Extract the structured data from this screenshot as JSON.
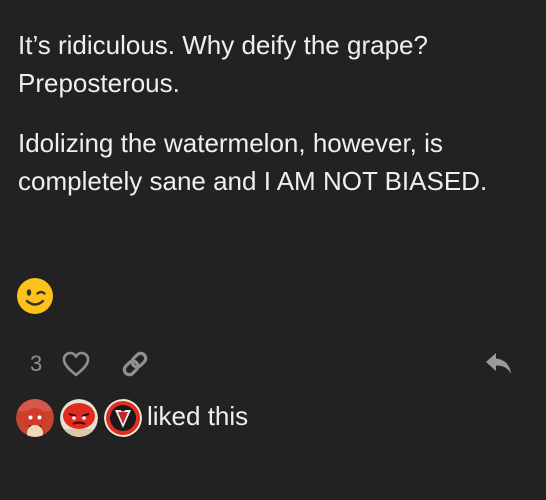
{
  "post": {
    "paragraphs": [
      "It’s ridiculous. Why deify the grape? Preposterous.",
      "Idolizing the watermelon, however, is completely sane and I AM NOT BIASED."
    ],
    "emoji": "wink-emoji"
  },
  "actions": {
    "like_count": "3",
    "like_icon": "heart-icon",
    "share_icon": "link-icon",
    "reply_icon": "reply-icon"
  },
  "likers": {
    "text": "liked this",
    "avatars": [
      "avatar-red-face",
      "avatar-red-face-2",
      "avatar-shield-emblem"
    ]
  },
  "colors": {
    "background": "#222222",
    "text": "#efefef",
    "muted": "#8f8f8f",
    "emoji_yellow": "#fcc21b"
  }
}
